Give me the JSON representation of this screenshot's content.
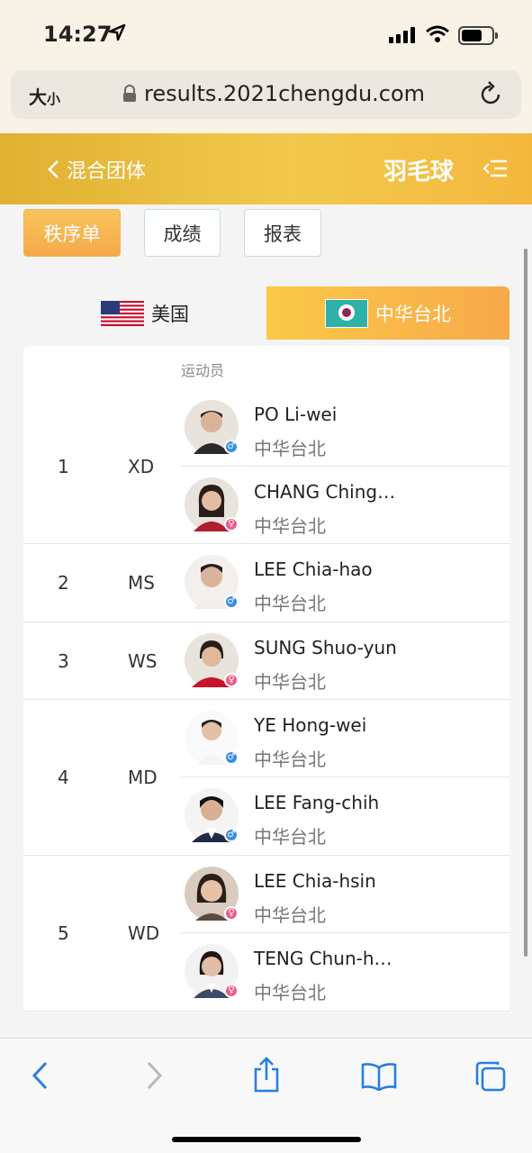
{
  "status": {
    "time": "14:27"
  },
  "browser": {
    "text_size": "大",
    "text_size_small": "小",
    "url": "results.2021chengdu.com"
  },
  "header": {
    "back_label": "混合团体",
    "sport": "羽毛球"
  },
  "tabs": [
    {
      "label": "秩序单",
      "active": true
    },
    {
      "label": "成绩",
      "active": false
    },
    {
      "label": "报表",
      "active": false
    }
  ],
  "teams": [
    {
      "name": "美国",
      "active": false
    },
    {
      "name": "中华台北",
      "active": true
    }
  ],
  "list": {
    "column_header": "运动员",
    "groups": [
      {
        "number": "1",
        "event": "XD",
        "players": [
          {
            "name": "PO Li-wei",
            "team": "中华台北",
            "gender": "male"
          },
          {
            "name": "CHANG Ching…",
            "team": "中华台北",
            "gender": "female"
          }
        ]
      },
      {
        "number": "2",
        "event": "MS",
        "players": [
          {
            "name": "LEE Chia-hao",
            "team": "中华台北",
            "gender": "male"
          }
        ]
      },
      {
        "number": "3",
        "event": "WS",
        "players": [
          {
            "name": "SUNG Shuo-yun",
            "team": "中华台北",
            "gender": "female"
          }
        ]
      },
      {
        "number": "4",
        "event": "MD",
        "players": [
          {
            "name": "YE Hong-wei",
            "team": "中华台北",
            "gender": "male"
          },
          {
            "name": "LEE Fang-chih",
            "team": "中华台北",
            "gender": "male"
          }
        ]
      },
      {
        "number": "5",
        "event": "WD",
        "players": [
          {
            "name": "LEE Chia-hsin",
            "team": "中华台北",
            "gender": "female"
          },
          {
            "name": "TENG Chun-h…",
            "team": "中华台北",
            "gender": "female"
          }
        ]
      }
    ]
  },
  "colors": {
    "accent": "#f4b73e",
    "header": "#e6b838",
    "male": "#3a8ee6",
    "female": "#ee5a8c"
  }
}
